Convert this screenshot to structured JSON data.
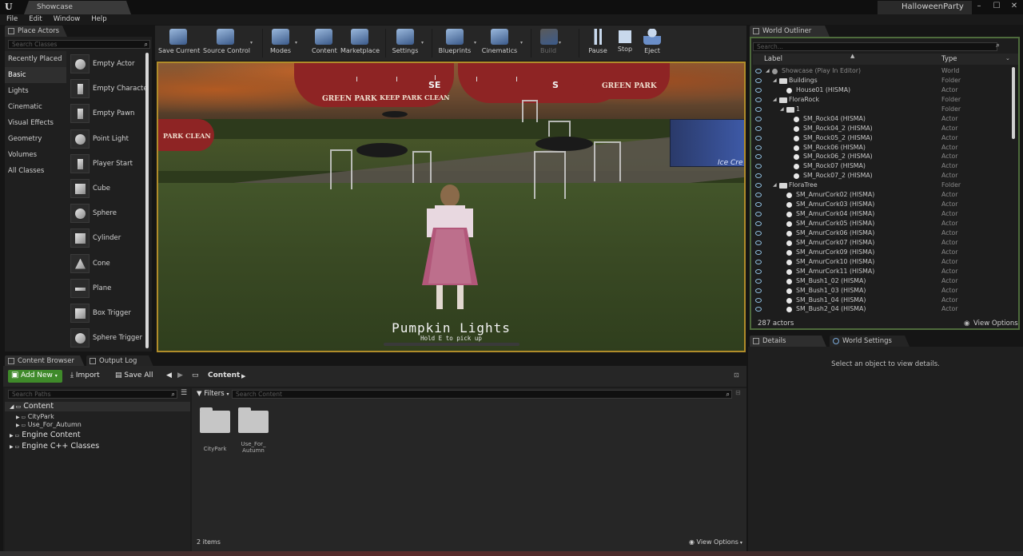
{
  "window": {
    "doc_tab": "Showcase",
    "project": "HalloweenParty",
    "controls": [
      "–",
      "☐",
      "✕"
    ]
  },
  "menu": [
    "File",
    "Edit",
    "Window",
    "Help"
  ],
  "place_actors": {
    "tab": "Place Actors",
    "search_placeholder": "Search Classes",
    "categories": [
      "Recently Placed",
      "Basic",
      "Lights",
      "Cinematic",
      "Visual Effects",
      "Geometry",
      "Volumes",
      "All Classes"
    ],
    "selected_category": "Basic",
    "actors": [
      "Empty Actor",
      "Empty Characte",
      "Empty Pawn",
      "Point Light",
      "Player Start",
      "Cube",
      "Sphere",
      "Cylinder",
      "Cone",
      "Plane",
      "Box Trigger",
      "Sphere Trigger"
    ]
  },
  "toolbar": {
    "buttons": [
      {
        "label": "Save Current",
        "icon": "save-icon"
      },
      {
        "label": "Source Control",
        "icon": "source-control-icon"
      },
      {
        "label": "Modes",
        "icon": "modes-icon"
      },
      {
        "label": "Content",
        "icon": "content-icon"
      },
      {
        "label": "Marketplace",
        "icon": "marketplace-icon"
      },
      {
        "label": "Settings",
        "icon": "settings-icon"
      },
      {
        "label": "Blueprints",
        "icon": "blueprints-icon"
      },
      {
        "label": "Cinematics",
        "icon": "cinematics-icon"
      },
      {
        "label": "Build",
        "icon": "build-icon"
      },
      {
        "label": "Pause",
        "icon": "pause-icon"
      },
      {
        "label": "Stop",
        "icon": "stop-icon"
      },
      {
        "label": "Eject",
        "icon": "eject-icon"
      }
    ]
  },
  "viewport": {
    "compass": [
      "SE",
      "S"
    ],
    "umbrella_texts": [
      "GREEN PARK",
      "KEEP PARK CLEAN",
      "GREEN PARK",
      "PARK CLEAN"
    ],
    "cart_text": "Ice Cre",
    "prompt_title": "Pumpkin Lights",
    "prompt_sub": "Hold E to pick up"
  },
  "outliner": {
    "tab": "World Outliner",
    "search_placeholder": "Search...",
    "col_label": "Label",
    "col_type": "Type",
    "rows": [
      {
        "label": "Showcase (Play In Editor)",
        "type": "World",
        "depth": 0,
        "kind": "world"
      },
      {
        "label": "Buildings",
        "type": "Folder",
        "depth": 1,
        "kind": "folder"
      },
      {
        "label": "House01 (HISMA)",
        "type": "Actor",
        "depth": 2,
        "kind": "actor"
      },
      {
        "label": "FloraRock",
        "type": "Folder",
        "depth": 1,
        "kind": "folder"
      },
      {
        "label": "1",
        "type": "Folder",
        "depth": 2,
        "kind": "folder"
      },
      {
        "label": "SM_Rock04 (HISMA)",
        "type": "Actor",
        "depth": 3,
        "kind": "actor"
      },
      {
        "label": "SM_Rock04_2 (HISMA)",
        "type": "Actor",
        "depth": 3,
        "kind": "actor"
      },
      {
        "label": "SM_Rock05_2 (HISMA)",
        "type": "Actor",
        "depth": 3,
        "kind": "actor"
      },
      {
        "label": "SM_Rock06 (HISMA)",
        "type": "Actor",
        "depth": 3,
        "kind": "actor"
      },
      {
        "label": "SM_Rock06_2 (HISMA)",
        "type": "Actor",
        "depth": 3,
        "kind": "actor"
      },
      {
        "label": "SM_Rock07 (HISMA)",
        "type": "Actor",
        "depth": 3,
        "kind": "actor"
      },
      {
        "label": "SM_Rock07_2 (HISMA)",
        "type": "Actor",
        "depth": 3,
        "kind": "actor"
      },
      {
        "label": "FloraTree",
        "type": "Folder",
        "depth": 1,
        "kind": "folder"
      },
      {
        "label": "SM_AmurCork02 (HISMA)",
        "type": "Actor",
        "depth": 2,
        "kind": "actor"
      },
      {
        "label": "SM_AmurCork03 (HISMA)",
        "type": "Actor",
        "depth": 2,
        "kind": "actor"
      },
      {
        "label": "SM_AmurCork04 (HISMA)",
        "type": "Actor",
        "depth": 2,
        "kind": "actor"
      },
      {
        "label": "SM_AmurCork05 (HISMA)",
        "type": "Actor",
        "depth": 2,
        "kind": "actor"
      },
      {
        "label": "SM_AmurCork06 (HISMA)",
        "type": "Actor",
        "depth": 2,
        "kind": "actor"
      },
      {
        "label": "SM_AmurCork07 (HISMA)",
        "type": "Actor",
        "depth": 2,
        "kind": "actor"
      },
      {
        "label": "SM_AmurCork09 (HISMA)",
        "type": "Actor",
        "depth": 2,
        "kind": "actor"
      },
      {
        "label": "SM_AmurCork10 (HISMA)",
        "type": "Actor",
        "depth": 2,
        "kind": "actor"
      },
      {
        "label": "SM_AmurCork11 (HISMA)",
        "type": "Actor",
        "depth": 2,
        "kind": "actor"
      },
      {
        "label": "SM_Bush1_02 (HISMA)",
        "type": "Actor",
        "depth": 2,
        "kind": "actor"
      },
      {
        "label": "SM_Bush1_03 (HISMA)",
        "type": "Actor",
        "depth": 2,
        "kind": "actor"
      },
      {
        "label": "SM_Bush1_04 (HISMA)",
        "type": "Actor",
        "depth": 2,
        "kind": "actor"
      },
      {
        "label": "SM_Bush2_04 (HISMA)",
        "type": "Actor",
        "depth": 2,
        "kind": "actor"
      }
    ],
    "count": "287 actors",
    "view_options": "View Options"
  },
  "details": {
    "tab": "Details",
    "tab2": "World Settings",
    "empty_msg": "Select an object to view details."
  },
  "content_browser": {
    "tab": "Content Browser",
    "tab2": "Output Log",
    "add_new": "Add New",
    "import": "Import",
    "save_all": "Save All",
    "path": "Content",
    "search_paths_placeholder": "Search Paths",
    "filters": "Filters",
    "search_content_placeholder": "Search Content",
    "tree": [
      {
        "label": "Content",
        "level": 0
      },
      {
        "label": "CityPark",
        "level": 1
      },
      {
        "label": "Use_For_Autumn",
        "level": 1
      },
      {
        "label": "Engine Content",
        "level": 0
      },
      {
        "label": "Engine C++ Classes",
        "level": 0
      }
    ],
    "folders": [
      "CityPark",
      "Use_For_\nAutumn"
    ],
    "item_count": "2 items",
    "view_options": "View Options"
  }
}
